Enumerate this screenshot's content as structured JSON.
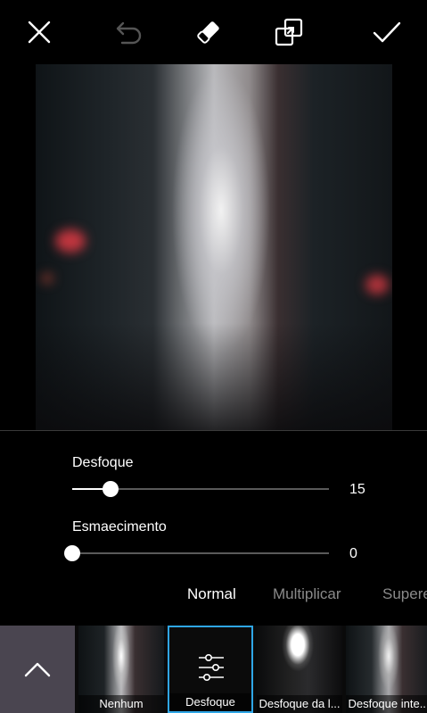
{
  "toolbar": {
    "icons": [
      "close-icon",
      "undo-icon",
      "eraser-icon",
      "compare-icon",
      "checkmark-icon"
    ]
  },
  "sliders": [
    {
      "label": "Desfoque",
      "value": "15",
      "fraction": 0.15
    },
    {
      "label": "Esmaecimento",
      "value": "0",
      "fraction": 0.0
    }
  ],
  "blend_modes": {
    "items": [
      "Normal",
      "Multiplicar",
      "Supere"
    ],
    "selected": "Normal"
  },
  "effects": {
    "expand_icon": "chevron-up-icon",
    "items": [
      {
        "label": "Nenhum"
      },
      {
        "label": "Desfoque",
        "selected": true,
        "icon": "sliders-icon"
      },
      {
        "label": "Desfoque da l..."
      },
      {
        "label": "Desfoque inte..."
      }
    ]
  },
  "colors": {
    "accent": "#2fa6e6",
    "inactive_text": "#8a8a8a",
    "expand_bg": "#4a4550"
  }
}
